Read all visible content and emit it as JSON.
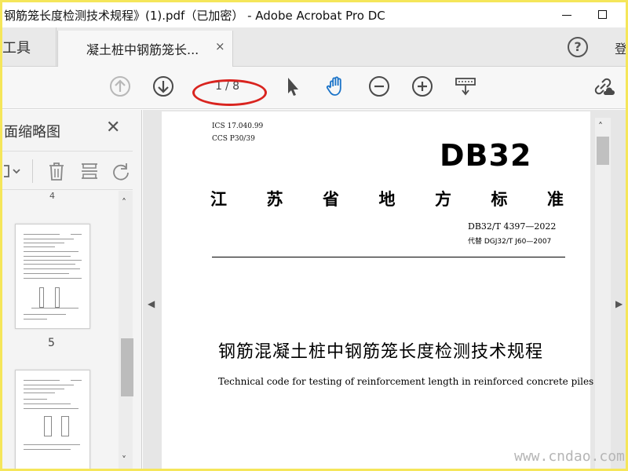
{
  "window": {
    "title": "钢筋笼长度检测技术规程》(1).pdf（已加密） - Adobe Acrobat Pro DC"
  },
  "tabs": {
    "tools_label": "工具",
    "doc_tab_label": "凝土桩中钢筋笼长...",
    "doc_tab_close": "×",
    "help_label": "?",
    "login_label": "登"
  },
  "toolbar": {
    "current_page": "1",
    "total_pages": "/ 8",
    "highlight_color": "#d9241f",
    "accent_color": "#1a73c8"
  },
  "sidebar": {
    "title": "面缩略图",
    "close": "✕",
    "thumbs": [
      {
        "label": "5"
      }
    ],
    "prev_label": "4"
  },
  "page": {
    "ics": "ICS  17.040.99",
    "ccs": "CCS  P30/39",
    "db_code": "DB32",
    "province_chars": [
      "江",
      "苏",
      "省",
      "地",
      "方",
      "标",
      "准"
    ],
    "std_number": "DB32/T 4397—2022",
    "replaces": "代替 DGJ32/T J60—2007",
    "title_zh": "钢筋混凝土桩中钢筋笼长度检测技术规程",
    "title_en": "Technical code for testing of reinforcement length in reinforced concrete piles"
  },
  "watermark": "www.cndao.com"
}
